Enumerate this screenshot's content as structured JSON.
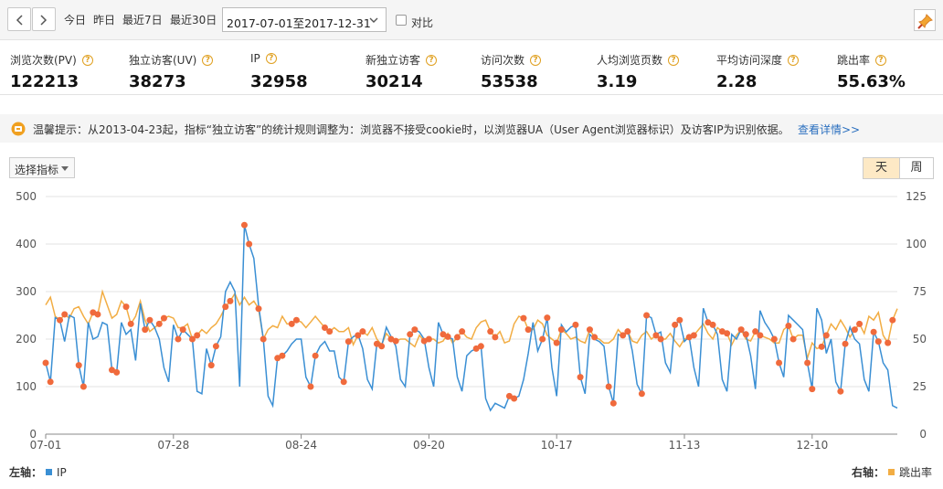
{
  "toolbar": {
    "prev_icon": "chevron-left-icon",
    "next_icon": "chevron-right-icon",
    "quick": [
      "今日",
      "昨日",
      "最近7日",
      "最近30日"
    ],
    "range": "2017-07-01至2017-12-31",
    "compare_label": "对比",
    "pin_icon": "pin-icon"
  },
  "metrics": [
    {
      "label": "浏览次数(PV)",
      "value": "122213"
    },
    {
      "label": "独立访客(UV)",
      "value": "38273"
    },
    {
      "label": "IP",
      "value": "32958"
    },
    {
      "label": "新独立访客",
      "value": "30214"
    },
    {
      "label": "访问次数",
      "value": "53538"
    },
    {
      "label": "人均浏览页数",
      "value": "3.19"
    },
    {
      "label": "平均访问深度",
      "value": "2.28"
    },
    {
      "label": "跳出率",
      "value": "55.63%"
    }
  ],
  "notice": {
    "icon": "alert-icon",
    "text": "温馨提示：从2013-04-23起，指标“独立访客”的统计规则调整为：浏览器不接受cookie时，以浏览器UA（User Agent浏览器标识）及访客IP为识别依据。",
    "link": "查看详情>>"
  },
  "chart_controls": {
    "metric_select": "选择指标",
    "day": "天",
    "week": "周"
  },
  "legend": {
    "left_label": "左轴：",
    "left_series": "IP",
    "right_label": "右轴：",
    "right_series": "跳出率"
  },
  "colors": {
    "ip": "#3a8fd4",
    "bounce": "#f2ad44",
    "dot": "#f06a3c"
  },
  "chart_data": {
    "type": "line",
    "x_ticks": [
      "07-01",
      "07-28",
      "08-24",
      "09-20",
      "10-17",
      "11-13",
      "12-10"
    ],
    "y_left": {
      "min": 0,
      "max": 500,
      "ticks": [
        0,
        100,
        200,
        300,
        400,
        500
      ]
    },
    "y_right": {
      "min": 0,
      "max": 125,
      "ticks": [
        0,
        25,
        50,
        75,
        100,
        125
      ]
    },
    "grid": true,
    "legend_position": "bottom",
    "series": [
      {
        "name": "IP",
        "axis": "left",
        "values": [
          150,
          110,
          245,
          240,
          195,
          250,
          245,
          145,
          100,
          235,
          200,
          205,
          235,
          230,
          135,
          130,
          235,
          210,
          220,
          155,
          275,
          220,
          240,
          225,
          200,
          140,
          110,
          230,
          200,
          220,
          210,
          200,
          90,
          85,
          180,
          145,
          185,
          205,
          300,
          320,
          300,
          100,
          440,
          400,
          370,
          270,
          200,
          80,
          60,
          160,
          165,
          175,
          190,
          200,
          200,
          120,
          100,
          165,
          185,
          195,
          175,
          175,
          120,
          110,
          195,
          205,
          210,
          180,
          115,
          95,
          190,
          185,
          225,
          205,
          185,
          115,
          100,
          210,
          220,
          215,
          200,
          140,
          100,
          235,
          210,
          205,
          200,
          120,
          90,
          165,
          175,
          180,
          185,
          75,
          50,
          65,
          60,
          55,
          80,
          75,
          80,
          115,
          170,
          235,
          175,
          200,
          245,
          140,
          80,
          230,
          215,
          225,
          230,
          120,
          85,
          210,
          200,
          195,
          185,
          100,
          65,
          210,
          205,
          220,
          175,
          105,
          85,
          250,
          245,
          210,
          215,
          150,
          130,
          230,
          240,
          195,
          205,
          140,
          100,
          265,
          235,
          230,
          210,
          115,
          90,
          210,
          200,
          220,
          210,
          165,
          95,
          260,
          235,
          220,
          200,
          150,
          120,
          250,
          240,
          230,
          220,
          150,
          95,
          265,
          240,
          170,
          200,
          110,
          90,
          190,
          225,
          200,
          190,
          115,
          90,
          215,
          195,
          150,
          135,
          60,
          55
        ]
      },
      {
        "name": "跳出率",
        "axis": "right",
        "values": [
          68,
          72,
          62,
          60,
          63,
          61,
          66,
          67,
          62,
          58,
          64,
          63,
          75,
          68,
          61,
          63,
          70,
          67,
          58,
          62,
          70,
          60,
          54,
          56,
          58,
          61,
          62,
          61,
          56,
          56,
          58,
          50,
          52,
          55,
          53,
          56,
          58,
          62,
          67,
          70,
          74,
          68,
          72,
          68,
          70,
          66,
          50,
          55,
          57,
          56,
          62,
          58,
          58,
          60,
          59,
          56,
          59,
          62,
          59,
          56,
          54,
          56,
          54,
          54,
          56,
          47,
          52,
          54,
          52,
          56,
          50,
          47,
          53,
          50,
          49,
          50,
          50,
          48,
          46,
          52,
          49,
          50,
          50,
          48,
          49,
          53,
          48,
          51,
          54,
          51,
          50,
          56,
          59,
          60,
          54,
          51,
          54,
          48,
          49,
          58,
          62,
          61,
          55,
          55,
          60,
          58,
          52,
          50,
          48,
          55,
          53,
          50,
          51,
          49,
          48,
          55,
          51,
          50,
          48,
          48,
          50,
          55,
          52,
          54,
          49,
          48,
          52,
          54,
          50,
          52,
          50,
          50,
          53,
          49,
          46,
          50,
          51,
          52,
          55,
          58,
          53,
          50,
          56,
          54,
          53,
          47,
          52,
          55,
          50,
          49,
          54,
          52,
          51,
          50,
          48,
          48,
          55,
          57,
          50,
          52,
          52,
          40,
          48,
          45,
          46,
          52,
          58,
          55,
          60,
          56,
          51,
          55,
          58,
          53,
          62,
          60,
          64,
          52,
          48,
          60,
          66
        ]
      }
    ]
  }
}
